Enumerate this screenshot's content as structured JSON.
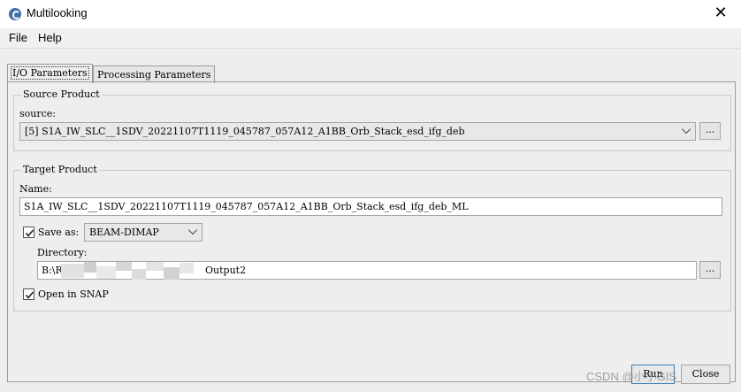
{
  "window": {
    "title": "Multilooking",
    "close_glyph": "✕"
  },
  "menu": [
    {
      "label": "File"
    },
    {
      "label": "Help"
    }
  ],
  "tabs": [
    {
      "label": "I/O Parameters"
    },
    {
      "label": "Processing Parameters"
    }
  ],
  "source_product": {
    "group_title": "Source Product",
    "source_label": "source:",
    "source_value": "[5] S1A_IW_SLC__1SDV_20221107T1119_045787_057A12_A1BB_Orb_Stack_esd_ifg_deb",
    "browse_label": "..."
  },
  "target_product": {
    "group_title": "Target Product",
    "name_label": "Name:",
    "name_value": "S1A_IW_SLC__1SDV_20221107T1119_045787_057A12_A1BB_Orb_Stack_esd_ifg_deb_ML",
    "save_as_label": "Save as:",
    "save_as_checked": true,
    "format_value": "BEAM-DIMAP",
    "directory_label": "Directory:",
    "directory_prefix": "B:\\R",
    "directory_suffix": "Output2",
    "browse_label": "...",
    "open_in_snap_label": "Open in SNAP",
    "open_in_snap_checked": true
  },
  "buttons": {
    "run": "Run",
    "close": "Close"
  },
  "watermark": "CSDN @小小GIS"
}
